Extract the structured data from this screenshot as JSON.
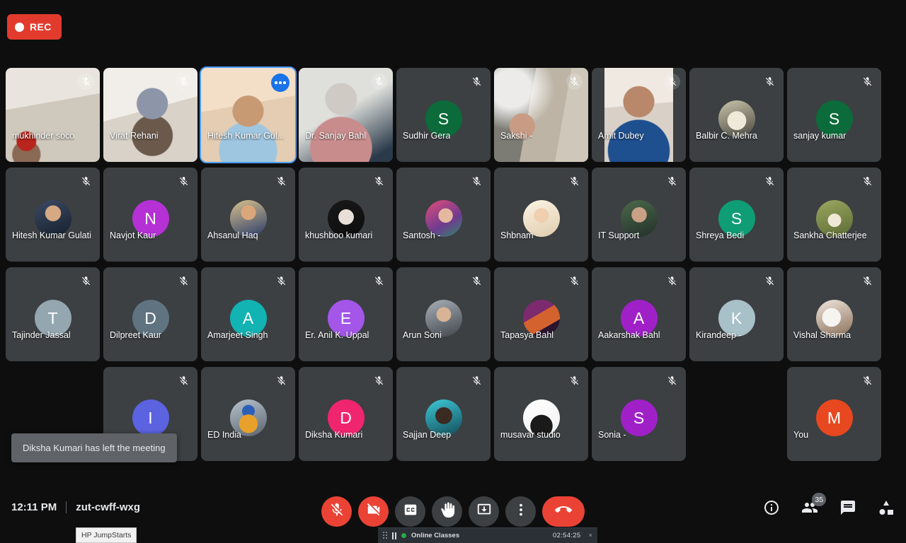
{
  "recording": {
    "label": "REC"
  },
  "toast": {
    "message": "Diksha Kumari has left the meeting"
  },
  "grid": {
    "rows": [
      [
        {
          "name": "mukhinder soco",
          "kind": "video",
          "bg": "bg-mukhinder",
          "muted": true
        },
        {
          "name": "Virat Rehani",
          "kind": "video",
          "bg": "bg-virat",
          "muted": true
        },
        {
          "name": "Hitesh Kumar Gul...",
          "kind": "video",
          "bg": "bg-hitesh",
          "muted": false,
          "active": true,
          "more": true
        },
        {
          "name": "Dr. Sanjay Bahl",
          "kind": "video",
          "bg": "bg-sanjay",
          "muted": true
        },
        {
          "name": "Sudhir Gera",
          "kind": "initial",
          "initial": "S",
          "color": "#0b6b3a",
          "muted": true
        },
        {
          "name": "Sakshi -",
          "kind": "video",
          "bg": "bg-sakshi",
          "muted": true
        },
        {
          "name": "Amit Dubey",
          "kind": "video",
          "bg": "bg-amit",
          "muted": true
        },
        {
          "name": "Balbir C. Mehra",
          "kind": "photo",
          "photo": "ph-balbir",
          "muted": true
        },
        {
          "name": "sanjay kumar",
          "kind": "initial",
          "initial": "S",
          "color": "#0b6b3a",
          "muted": true
        }
      ],
      [
        {
          "name": "Hitesh Kumar Gulati",
          "kind": "photo",
          "photo": "ph-hitesh2",
          "muted": true
        },
        {
          "name": "Navjot Kaur",
          "kind": "initial",
          "initial": "N",
          "color": "#b531d6",
          "muted": true
        },
        {
          "name": "Ahsanul Haq",
          "kind": "photo",
          "photo": "ph-ahsanul",
          "muted": true
        },
        {
          "name": "khushboo kumari",
          "kind": "photo",
          "photo": "ph-khushboo",
          "muted": true
        },
        {
          "name": "Santosh -",
          "kind": "photo",
          "photo": "ph-santosh",
          "muted": true
        },
        {
          "name": "Shbnam -",
          "kind": "photo",
          "photo": "ph-shbnam",
          "muted": true
        },
        {
          "name": "IT Support",
          "kind": "photo",
          "photo": "ph-it",
          "muted": true
        },
        {
          "name": "Shreya Bedi",
          "kind": "initial",
          "initial": "S",
          "color": "#0f9d76",
          "muted": true
        },
        {
          "name": "Sankha Chatterjee",
          "kind": "photo",
          "photo": "ph-sankha",
          "muted": true
        }
      ],
      [
        {
          "name": "Tajinder Jassal",
          "kind": "initial",
          "initial": "T",
          "color": "#94a7b0",
          "muted": true
        },
        {
          "name": "Dilpreet Kaur",
          "kind": "initial",
          "initial": "D",
          "color": "#5f7480",
          "muted": true
        },
        {
          "name": "Amarjeet Singh",
          "kind": "initial",
          "initial": "A",
          "color": "#11b3b3",
          "muted": true
        },
        {
          "name": "Er. Anil K. Uppal",
          "kind": "initial",
          "initial": "E",
          "color": "#a356e8",
          "muted": true
        },
        {
          "name": "Arun Soni",
          "kind": "photo",
          "photo": "ph-arun",
          "muted": true
        },
        {
          "name": "Tapasya Bahl",
          "kind": "photo",
          "photo": "ph-tapasya",
          "muted": true
        },
        {
          "name": "Aakarshak Bahl",
          "kind": "initial",
          "initial": "A",
          "color": "#a020c8",
          "muted": true
        },
        {
          "name": "Kirandeep -",
          "kind": "initial",
          "initial": "K",
          "color": "#a8c0c8",
          "muted": true
        },
        {
          "name": "Vishal Sharma",
          "kind": "photo",
          "photo": "ph-vishal",
          "muted": true
        }
      ],
      [
        {
          "name": "",
          "kind": "spacer"
        },
        {
          "name": "",
          "kind": "initial",
          "initial": "I",
          "color": "#5b63e0",
          "muted": true
        },
        {
          "name": "ED India",
          "kind": "photo",
          "photo": "ph-edindia",
          "muted": true
        },
        {
          "name": "Diksha Kumari",
          "kind": "initial",
          "initial": "D",
          "color": "#f0256f",
          "muted": true
        },
        {
          "name": "Sajjan Deep",
          "kind": "photo",
          "photo": "ph-sajjan",
          "muted": true
        },
        {
          "name": "musavar studio",
          "kind": "photo",
          "photo": "ph-musavar",
          "muted": true
        },
        {
          "name": "Sonia -",
          "kind": "initial",
          "initial": "S",
          "color": "#a020c8",
          "muted": true
        },
        {
          "name": "",
          "kind": "spacer"
        },
        {
          "name": "You",
          "kind": "initial",
          "initial": "M",
          "color": "#e8481f",
          "muted": true
        }
      ]
    ]
  },
  "bottom": {
    "time": "12:11 PM",
    "meeting_code": "zut-cwff-wxg",
    "controls": [
      {
        "name": "microphone-off-button",
        "icon": "mic-off-icon",
        "danger": true
      },
      {
        "name": "camera-off-button",
        "icon": "camera-off-icon",
        "danger": true
      },
      {
        "name": "captions-button",
        "icon": "cc-icon",
        "danger": false
      },
      {
        "name": "raise-hand-button",
        "icon": "hand-icon",
        "danger": false
      },
      {
        "name": "present-now-button",
        "icon": "present-icon",
        "danger": false
      },
      {
        "name": "more-options-button",
        "icon": "more-vertical-icon",
        "danger": false
      },
      {
        "name": "end-call-button",
        "icon": "phone-hangup-icon",
        "danger": true
      }
    ],
    "right_icons": [
      {
        "name": "meeting-details-button",
        "icon": "info-icon",
        "badge": null
      },
      {
        "name": "show-everyone-button",
        "icon": "people-icon",
        "badge": "35"
      },
      {
        "name": "chat-button",
        "icon": "chat-icon",
        "badge": null
      },
      {
        "name": "activities-button",
        "icon": "activities-icon",
        "badge": null
      }
    ]
  },
  "rec_strip": {
    "title": "Online Classes",
    "timer": "02:54:25",
    "close": "×"
  },
  "taskbar_tip": {
    "label": "HP JumpStarts"
  }
}
